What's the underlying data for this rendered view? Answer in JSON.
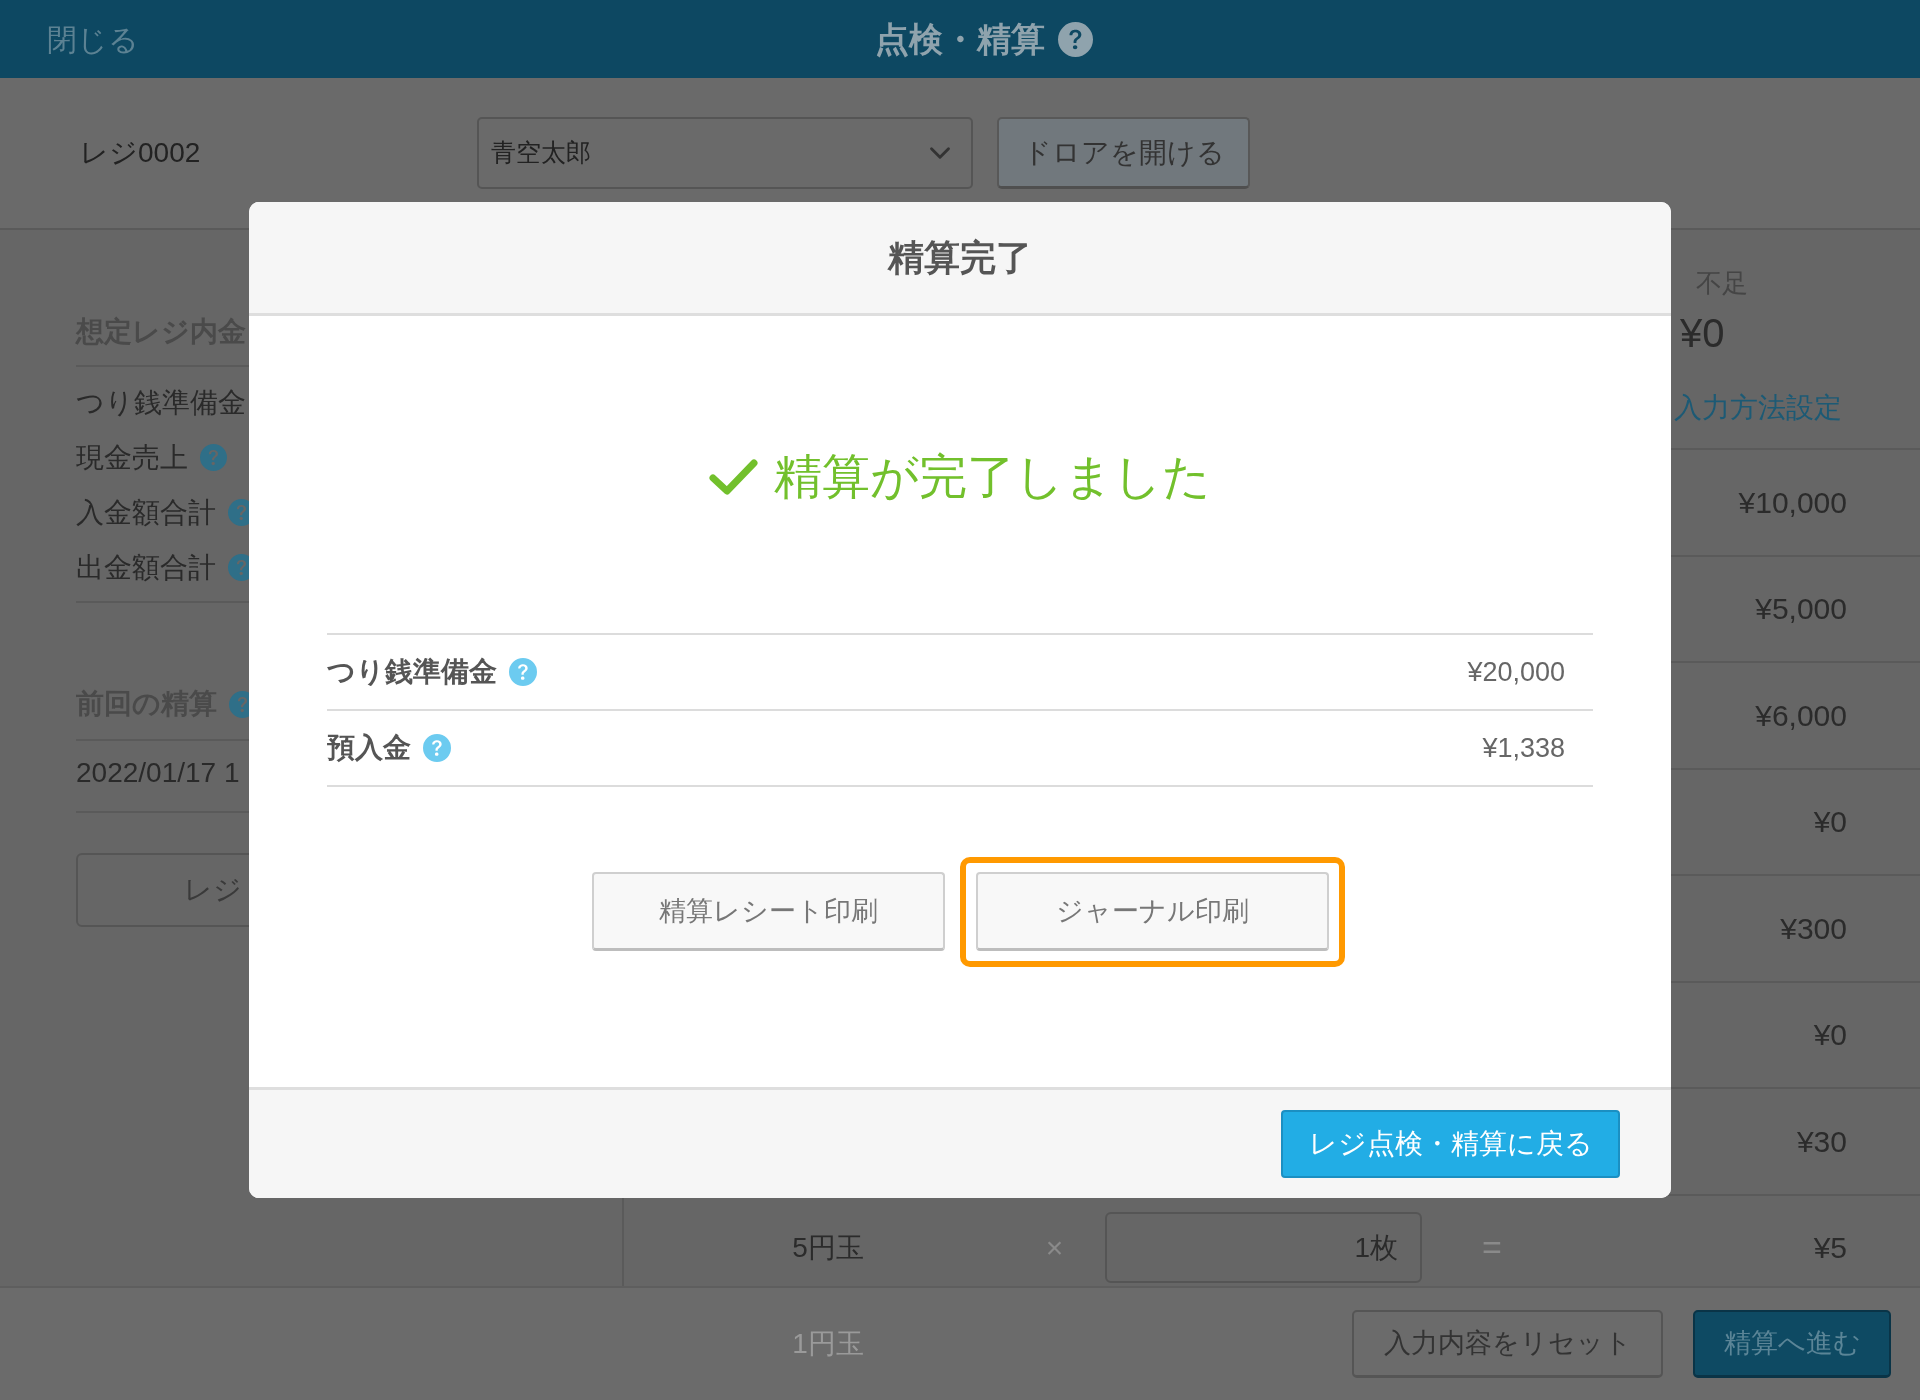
{
  "top_bar": {
    "close": "閉じる",
    "title": "点検・精算"
  },
  "register_bar": {
    "register": "レジ0002",
    "staff_select": {
      "value": "青空太郎"
    },
    "drawer_button": "ドロアを開ける"
  },
  "left_panel": {
    "expected_heading": "想定レジ内金",
    "expected_rows": [
      {
        "label": "つり銭準備金",
        "help": false
      },
      {
        "label": "現金売上",
        "help": true
      },
      {
        "label": "入金額合計",
        "help": true
      },
      {
        "label": "出金額合計",
        "help": true
      }
    ],
    "previous_heading": "前回の精算",
    "previous_help": true,
    "previous_date": "2022/01/17 1",
    "register_button": "レジ"
  },
  "summary": {
    "label": "不足",
    "amount": "¥0",
    "link": "入力方法設定"
  },
  "denomination_rows": [
    {
      "kind": "partial",
      "amount": "¥10,000"
    },
    {
      "kind": "partial",
      "amount": "¥5,000"
    },
    {
      "kind": "partial",
      "amount": "¥6,000"
    },
    {
      "kind": "partial",
      "amount": "¥0"
    },
    {
      "kind": "partial",
      "amount": "¥300"
    },
    {
      "kind": "partial",
      "amount": "¥0"
    },
    {
      "kind": "partial",
      "amount": "¥30"
    },
    {
      "kind": "full",
      "coin": "5円玉",
      "times": "×",
      "count": "1枚",
      "equals": "=",
      "amount": "¥5"
    }
  ],
  "footer": {
    "next_coin": "1円玉",
    "reset_button": "入力内容をリセット",
    "proceed_button": "精算へ進む"
  },
  "dialog": {
    "title": "精算完了",
    "message": "精算が完了しました",
    "rows": [
      {
        "label": "つり銭準備金",
        "help": true,
        "amount": "¥20,000"
      },
      {
        "label": "預入金",
        "help": true,
        "amount": "¥1,338"
      }
    ],
    "print_buttons": [
      {
        "label": "精算レシート印刷",
        "highlighted": false
      },
      {
        "label": "ジャーナル印刷",
        "highlighted": true
      }
    ],
    "back_button": "レジ点検・精算に戻る"
  }
}
